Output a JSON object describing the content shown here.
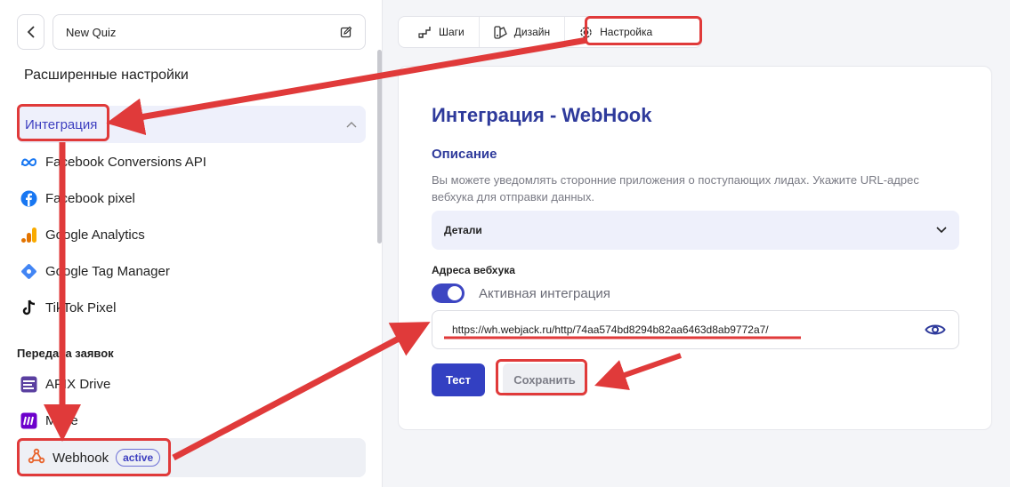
{
  "sidebar": {
    "quiz_name": "New Quiz",
    "advanced_title": "Расширенные настройки",
    "section_label": "Интеграция",
    "integrations": [
      {
        "label": "Facebook Conversions API",
        "icon": "meta-icon"
      },
      {
        "label": "Facebook pixel",
        "icon": "facebook-icon"
      },
      {
        "label": "Google Analytics",
        "icon": "google-analytics-icon"
      },
      {
        "label": "Google Tag Manager",
        "icon": "google-tag-manager-icon"
      },
      {
        "label": "TikTok Pixel",
        "icon": "tiktok-icon"
      }
    ],
    "transfer_title": "Передача заявок",
    "transfer_items": [
      {
        "label": "APIX Drive",
        "icon": "apix-drive-icon"
      },
      {
        "label": "Make",
        "icon": "make-icon"
      }
    ],
    "webhook": {
      "label": "Webhook",
      "badge": "active"
    }
  },
  "tabs": [
    {
      "label": "Шаги",
      "icon": "steps-icon"
    },
    {
      "label": "Дизайн",
      "icon": "design-icon"
    },
    {
      "label": "Настройка",
      "icon": "gear-icon"
    }
  ],
  "main": {
    "title": "Интеграция - WebHook",
    "description_label": "Описание",
    "description_text": "Вы можете уведомлять сторонние приложения о поступающих лидах. Укажите URL-адрес вебхука для отправки данных.",
    "details_label": "Детали",
    "addresses_label": "Адреса вебхука",
    "toggle_label": "Активная интеграция",
    "toggle_on": true,
    "webhook_url": "https://wh.webjack.ru/http/74aa574bd8294b82aa6463d8ab9772a7/",
    "test_button": "Тест",
    "save_button": "Сохранить"
  },
  "colors": {
    "accent": "#3340c2",
    "heading": "#2e3a9b",
    "highlight": "#e03a3a"
  }
}
